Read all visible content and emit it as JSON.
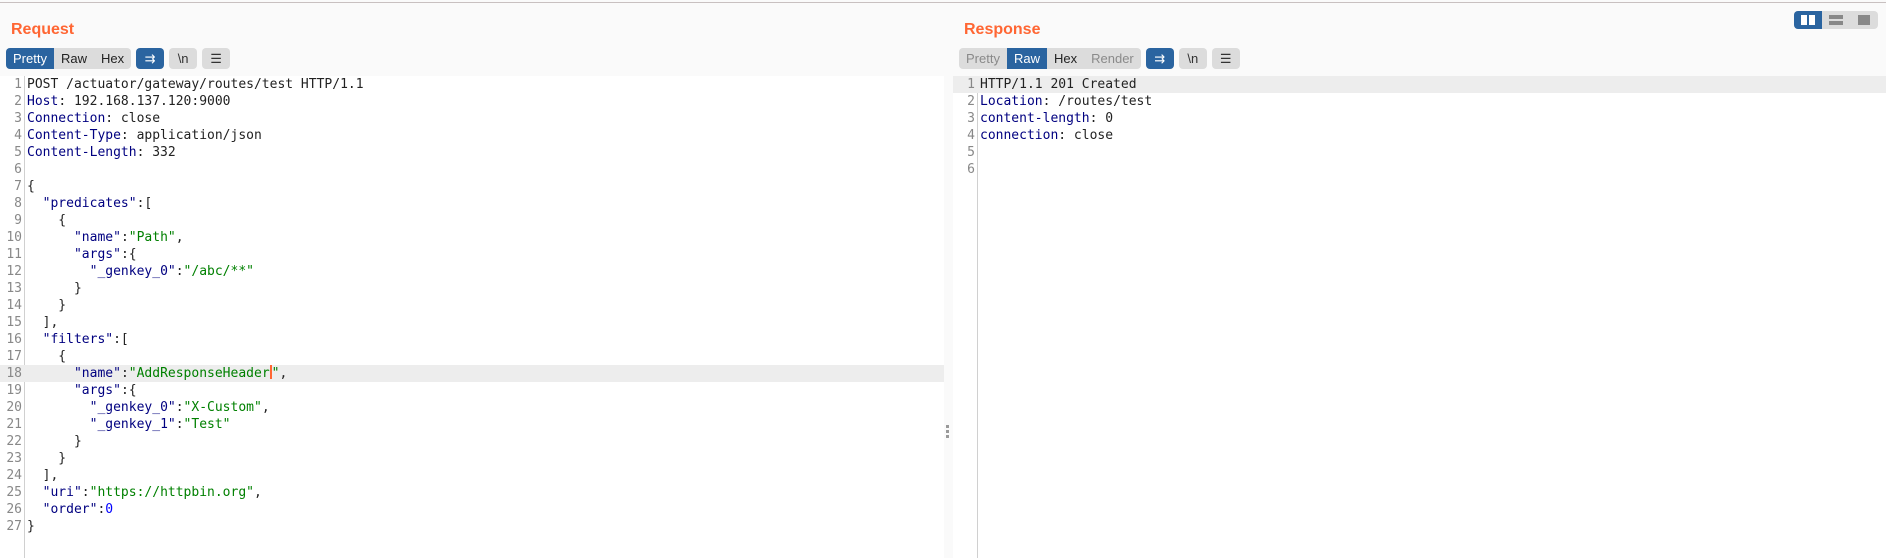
{
  "request": {
    "title": "Request",
    "tabs": [
      {
        "label": "Pretty",
        "active": true
      },
      {
        "label": "Raw"
      },
      {
        "label": "Hex"
      }
    ],
    "icons": [
      "wrap-icon",
      "newline-icon",
      "menu-icon"
    ],
    "newline_label": "\\n",
    "cursor_line": 18,
    "lines": [
      [
        [
          "p",
          "POST /actuator/gateway/routes/test HTTP/1.1"
        ]
      ],
      [
        [
          "k",
          "Host"
        ],
        [
          "p",
          ": 192.168.137.120:9000"
        ]
      ],
      [
        [
          "k",
          "Connection"
        ],
        [
          "p",
          ": close"
        ]
      ],
      [
        [
          "k",
          "Content-Type"
        ],
        [
          "p",
          ": application/json"
        ]
      ],
      [
        [
          "k",
          "Content-Length"
        ],
        [
          "p",
          ": 332"
        ]
      ],
      [],
      [
        [
          "p",
          "{"
        ]
      ],
      [
        [
          "p",
          "  "
        ],
        [
          "k",
          "\"predicates\""
        ],
        [
          "p",
          ":["
        ]
      ],
      [
        [
          "p",
          "    {"
        ]
      ],
      [
        [
          "p",
          "      "
        ],
        [
          "k",
          "\"name\""
        ],
        [
          "p",
          ":"
        ],
        [
          "s",
          "\"Path\""
        ],
        [
          "p",
          ","
        ]
      ],
      [
        [
          "p",
          "      "
        ],
        [
          "k",
          "\"args\""
        ],
        [
          "p",
          ":{"
        ]
      ],
      [
        [
          "p",
          "        "
        ],
        [
          "k",
          "\"_genkey_0\""
        ],
        [
          "p",
          ":"
        ],
        [
          "s",
          "\"/abc/**\""
        ]
      ],
      [
        [
          "p",
          "      }"
        ]
      ],
      [
        [
          "p",
          "    }"
        ]
      ],
      [
        [
          "p",
          "  ],"
        ]
      ],
      [
        [
          "p",
          "  "
        ],
        [
          "k",
          "\"filters\""
        ],
        [
          "p",
          ":["
        ]
      ],
      [
        [
          "p",
          "    {"
        ]
      ],
      [
        [
          "p",
          "      "
        ],
        [
          "k",
          "\"name\""
        ],
        [
          "p",
          ":"
        ],
        [
          "s",
          "\"AddResponseHeader"
        ],
        [
          "c",
          ""
        ],
        [
          "s",
          "\""
        ],
        [
          "p",
          ","
        ]
      ],
      [
        [
          "p",
          "      "
        ],
        [
          "k",
          "\"args\""
        ],
        [
          "p",
          ":{"
        ]
      ],
      [
        [
          "p",
          "        "
        ],
        [
          "k",
          "\"_genkey_0\""
        ],
        [
          "p",
          ":"
        ],
        [
          "s",
          "\"X-Custom\""
        ],
        [
          "p",
          ","
        ]
      ],
      [
        [
          "p",
          "        "
        ],
        [
          "k",
          "\"_genkey_1\""
        ],
        [
          "p",
          ":"
        ],
        [
          "s",
          "\"Test\""
        ]
      ],
      [
        [
          "p",
          "      }"
        ]
      ],
      [
        [
          "p",
          "    }"
        ]
      ],
      [
        [
          "p",
          "  ],"
        ]
      ],
      [
        [
          "p",
          "  "
        ],
        [
          "k",
          "\"uri\""
        ],
        [
          "p",
          ":"
        ],
        [
          "s",
          "\"https://httpbin.org\""
        ],
        [
          "p",
          ","
        ]
      ],
      [
        [
          "p",
          "  "
        ],
        [
          "k",
          "\"order\""
        ],
        [
          "p",
          ":"
        ],
        [
          "n",
          "0"
        ]
      ],
      [
        [
          "p",
          "}"
        ]
      ]
    ]
  },
  "response": {
    "title": "Response",
    "tabs": [
      {
        "label": "Pretty",
        "dim": true
      },
      {
        "label": "Raw",
        "active": true
      },
      {
        "label": "Hex"
      },
      {
        "label": "Render",
        "dim": true
      }
    ],
    "icons": [
      "wrap-icon",
      "newline-icon",
      "menu-icon"
    ],
    "newline_label": "\\n",
    "cursor_line": 1,
    "lines": [
      [
        [
          "p",
          "HTTP/1.1 201 Created"
        ]
      ],
      [
        [
          "k",
          "Location"
        ],
        [
          "p",
          ": /routes/test"
        ]
      ],
      [
        [
          "k",
          "content-length"
        ],
        [
          "p",
          ": 0"
        ]
      ],
      [
        [
          "k",
          "connection"
        ],
        [
          "p",
          ": close"
        ]
      ],
      [],
      []
    ]
  },
  "layout_views": [
    {
      "name": "side-by-side-view",
      "active": true
    },
    {
      "name": "top-bottom-view"
    },
    {
      "name": "single-view"
    }
  ],
  "colors": {
    "accent": "#ff6633",
    "active": "#2a64a0",
    "key": "#000080",
    "string": "#008000",
    "number": "#0000ff"
  }
}
